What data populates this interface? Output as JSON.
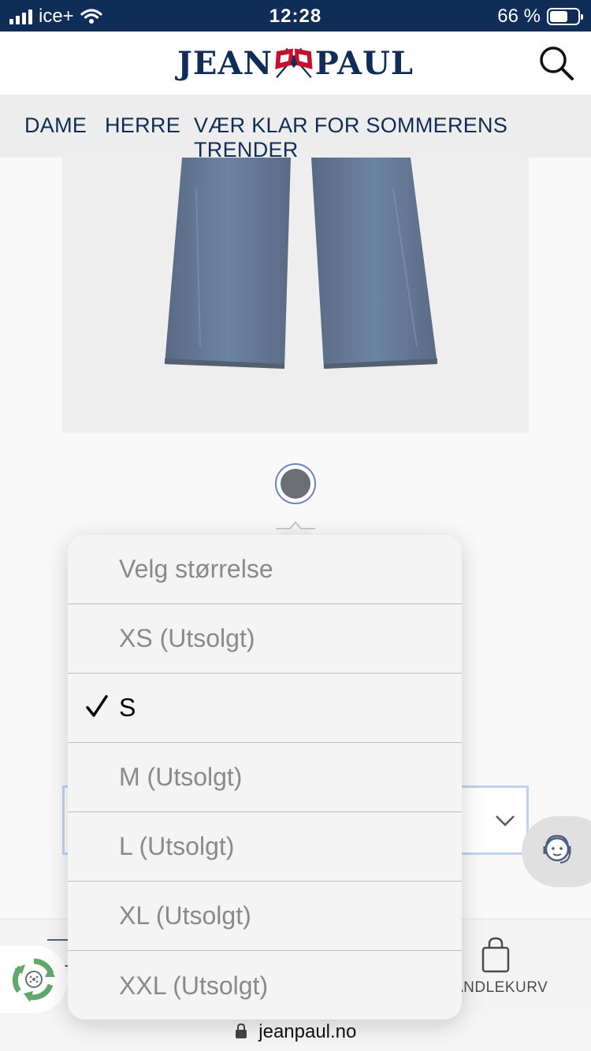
{
  "status_bar": {
    "carrier": "ice+",
    "time": "12:28",
    "battery_percent": "66 %",
    "battery_level": 0.66
  },
  "header": {
    "brand_left": "JEAN",
    "brand_right": "PAUL",
    "search_icon": "search-icon"
  },
  "nav": {
    "items": [
      {
        "label": "DAME"
      },
      {
        "label": "HERRE"
      },
      {
        "label": "VÆR KLAR FOR SOMMERENS TRENDER"
      }
    ]
  },
  "size_picker": {
    "options": [
      {
        "label": "Velg størrelse",
        "selected": false
      },
      {
        "label": "XS (Utsolgt)",
        "selected": false
      },
      {
        "label": "S",
        "selected": true
      },
      {
        "label": "M (Utsolgt)",
        "selected": false
      },
      {
        "label": "L (Utsolgt)",
        "selected": false
      },
      {
        "label": "XL (Utsolgt)",
        "selected": false
      },
      {
        "label": "XXL (Utsolgt)",
        "selected": false
      }
    ]
  },
  "bottom_bar": {
    "cart_label": "ANDLEKURV"
  },
  "browser": {
    "url": "jeanpaul.no"
  },
  "colors": {
    "brand_navy": "#0f2d57",
    "status_bar_bg": "#0f2d57",
    "select_border": "#a9c6e6",
    "recycle_green": "#2e8b3a"
  }
}
